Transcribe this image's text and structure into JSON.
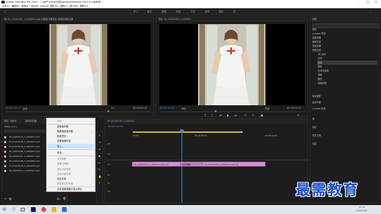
{
  "window": {
    "title": "Adobe Premiere Pro 2020 - C:\\用户\\Fbka\\文档\\Adobe\\Premiere Pro\\14.0\\未命名 *"
  },
  "menu": [
    "文件(F)",
    "编辑(E)",
    "剪辑(C)",
    "序列(S)",
    "标记(M)",
    "图形(G)",
    "视图(V)",
    "窗口(W)",
    "帮助(H)"
  ],
  "workspaces": {
    "items": [
      "学习",
      "组件",
      "编辑",
      "颜色",
      "效果",
      "音频",
      "图形",
      "库"
    ],
    "active_index": 4
  },
  "source": {
    "tab": "源: 00_01003103_3_000003.mp4 元数据 效果控件 音频剪辑混合器",
    "tab2": "效果控件",
    "timecode": "00:00:03:13",
    "fit": "适合",
    "ratio": "1/2",
    "duration": "00:00:05:00"
  },
  "program": {
    "tab": "节目: 00_01003103_3_000003",
    "timecode": "00:00:04:02",
    "fit": "适合",
    "ratio": "完整",
    "duration": "00:00:10:10"
  },
  "effects_panel": {
    "title": "效果",
    "tree": [
      "预设",
      "Lumetri 预设",
      "音频效果",
      "音频过渡",
      "视频效果",
      "视频过渡",
      "3D 运动",
      "内滑",
      "划像",
      "擦除",
      "沉浸式视频",
      "溶解",
      "缩放",
      "页面剥落"
    ],
    "lower": [
      "基本图形",
      "基本声音",
      "Lumetri 颜色",
      "库",
      "标记",
      "历史记录",
      "信息"
    ]
  },
  "project": {
    "tab": "项目: 未命名",
    "tab2": "媒体浏览器",
    "path": "未命名.prproj",
    "items": [
      {
        "name": "00_01003103_3_000003.mp4",
        "color": "#e6a0e6"
      },
      {
        "name": "00_01003104_3_000004.mp4",
        "color": "#e6a0e6"
      },
      {
        "name": "00_01003105_3_000005.mp4",
        "color": "#e6a0e6"
      },
      {
        "name": "00_01003106_3_000006.mp4",
        "color": "#e6a0e6"
      },
      {
        "name": "00_01003107_3_000007.mp4",
        "color": "#e6a0e6"
      },
      {
        "name": "00_01003108_3_000008.mp4",
        "color": "#8fd98f"
      },
      {
        "name": "00_01003109_3_000009.mp4",
        "color": "#e6a0e6"
      },
      {
        "name": "00_01003110_3_000010.mp4",
        "color": "#5fcfcf"
      }
    ]
  },
  "context_menu": {
    "items": [
      "粘贴",
      "新建素材箱",
      "新建搜索素材箱",
      "新建项目",
      "查看隐藏内容",
      "导入...",
      "查找...",
      "对齐网格",
      "重置为网格",
      "保存当前布局",
      "另存为新布局",
      "恢复布局",
      "管理保存的布局",
      "在资源管理器中显示项目"
    ],
    "highlight_index": 5
  },
  "timeline": {
    "tab": "00_01003103_3_000003",
    "timecode": "00:00:04:02",
    "ruler": [
      "00:00",
      "00:00:05:00",
      "00:00:10:00"
    ],
    "tracks": [
      "V3",
      "V2",
      "V1",
      "A1",
      "A2",
      "A3"
    ],
    "clips": [
      {
        "label": "00_01003103_3_000003.mp4 [V]"
      },
      {
        "label": "交叉溶解"
      },
      {
        "label": "00_01003104_3_000004.mp4 [V]"
      }
    ]
  },
  "taskbar": {
    "time": "17:27",
    "date": "2021/7/24"
  },
  "watermark": "最需教育"
}
